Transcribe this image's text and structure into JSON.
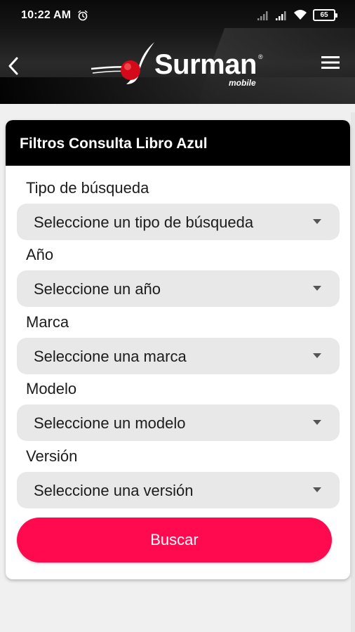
{
  "status_bar": {
    "time": "10:22 AM",
    "battery": "65",
    "icons": [
      "alarm-icon",
      "signal-icon",
      "signal-icon",
      "wifi-icon",
      "battery-icon"
    ]
  },
  "app_bar": {
    "back_icon": "chevron-left-icon",
    "menu_icon": "hamburger-menu-icon",
    "logo": {
      "word": "Surman",
      "sub": "mobile",
      "reg": "®"
    }
  },
  "card": {
    "title": "Filtros Consulta Libro Azul",
    "fields": [
      {
        "label": "Tipo de búsqueda",
        "value": "Seleccione un tipo de búsqueda"
      },
      {
        "label": "Año",
        "value": "Seleccione un año"
      },
      {
        "label": "Marca",
        "value": "Seleccione una marca"
      },
      {
        "label": "Modelo",
        "value": "Seleccione un modelo"
      },
      {
        "label": "Versión",
        "value": "Seleccione una versión"
      }
    ],
    "button": "Buscar"
  },
  "colors": {
    "accent": "#ff0a4e",
    "header_bg": "#000000",
    "select_bg": "#e8e8e8",
    "page_bg": "#f0f0f0"
  }
}
